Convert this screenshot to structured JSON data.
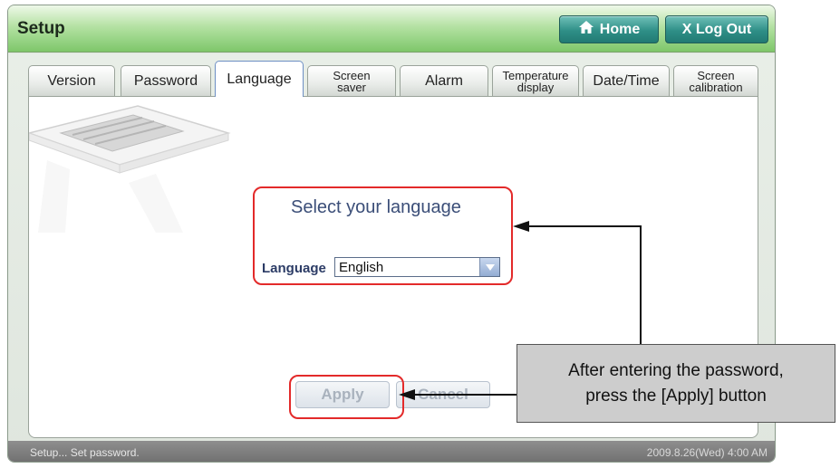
{
  "window": {
    "title": "Setup"
  },
  "header": {
    "home_label": "Home",
    "logout_label": "X Log Out"
  },
  "tabs": [
    {
      "label": "Version"
    },
    {
      "label": "Password"
    },
    {
      "label": "Language",
      "active": true
    },
    {
      "label_line1": "Screen",
      "label_line2": "saver"
    },
    {
      "label": "Alarm"
    },
    {
      "label_line1": "Temperature",
      "label_line2": "display"
    },
    {
      "label": "Date/Time"
    },
    {
      "label_line1": "Screen",
      "label_line2": "calibration"
    }
  ],
  "language_panel": {
    "heading": "Select your language",
    "field_label": "Language",
    "selected_value": "English"
  },
  "buttons": {
    "apply_label": "Apply",
    "cancel_label": "Cancel"
  },
  "status_bar": {
    "message": "Setup... Set password.",
    "datetime": "2009.8.26(Wed)  4:00 AM"
  },
  "annotation": {
    "line1": "After entering the password,",
    "line2": "press the [Apply] button"
  },
  "colors": {
    "highlight": "#e32a2a",
    "header_green": "#7ec76a",
    "button_teal": "#2f8f87"
  }
}
